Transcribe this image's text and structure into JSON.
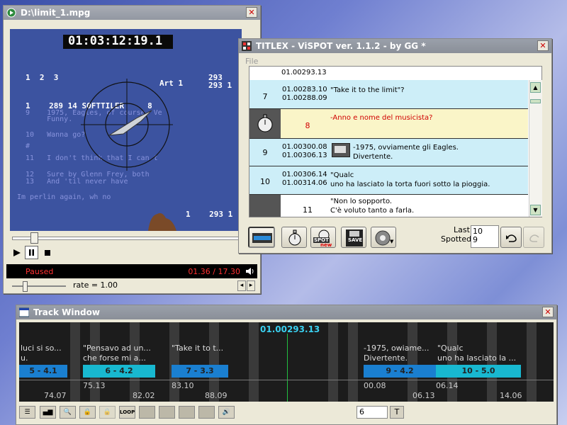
{
  "player": {
    "title": "D:\\limit_1.mpg",
    "video": {
      "timecode": "01:03:12:19.1",
      "lines": [
        "1  2  3",
        "Art 1",
        "293",
        "293 1",
        "1    289 14 SOFTTILER     8",
        "1    293 1"
      ],
      "blue_lines": [
        "9    1975, Eagles, of course. Ve",
        "     Funny.",
        "10   Wanna go?",
        "#",
        "11   I don't think that I can t",
        "12   Sure by Glenn Frey, both",
        "13   And 'til never have",
        "Im perlin again, wh no"
      ]
    },
    "status": "Paused",
    "time": "01.36 / 17.30",
    "rate": "rate = 1.00"
  },
  "titlex": {
    "title": "TITLEX - ViSPOT ver. 1.1.2 - by GG *",
    "menu_file": "File",
    "top_time": "01.00293.13",
    "rows": [
      {
        "num": "7",
        "t1": "01.00283.10",
        "t2": "01.00288.09",
        "text1": "\"Take it to the limit\"?",
        "text2": ""
      },
      {
        "num": "8",
        "t1": "",
        "t2": "",
        "text1": "-Anno e nome del musicista?",
        "text2": ""
      },
      {
        "num": "9",
        "t1": "01.00300.08",
        "t2": "01.00306.13",
        "text1": "-1975, ovviamente gli Eagles.",
        "text2": "Divertente."
      },
      {
        "num": "10",
        "t1": "01.00306.14",
        "t2": "01.00314.06",
        "text1": "\"Qualc",
        "text2": "uno ha lasciato la torta fuori sotto la pioggia."
      },
      {
        "num": "11",
        "t1": "",
        "t2": "",
        "text1": "\"Non lo sopporto.",
        "text2": "C'è voluto tanto a farla."
      }
    ],
    "last_label": "Last",
    "spotted_label": "Spotted",
    "last_value": "10",
    "spotted_value": "9",
    "btn_spot": "SPOT",
    "btn_new": "new",
    "btn_save": "SAVE"
  },
  "track": {
    "title": "Track Window",
    "current_time": "01.00293.13",
    "texts": [
      "luci si so...\nu.",
      "\"Pensavo ad un...\nche forse mi a...",
      "\"Take it to t...",
      "-1975, owiame...\nDivertente.",
      "\"Qualc\nuno ha lasciato la ..."
    ],
    "segments": [
      "5 - 4.1",
      "6 - 4.2",
      "7 - 3.3",
      "9 - 4.2",
      "10 - 5.0"
    ],
    "codes_bottom": [
      "74.07",
      "75.13",
      "82.02",
      "83.10",
      "88.09",
      "00.08",
      "06.13",
      "06.14",
      "14.06"
    ],
    "counter": "6",
    "t_button": "T",
    "loop_label": "LOOP"
  },
  "colors": {
    "row_cyan": "#cdeef8",
    "row_yellow": "#faf5c8",
    "seg_blue": "#1a7fd0",
    "seg_cyan": "#18b8d0",
    "timecode_cyan": "#3ad0f0",
    "status_red": "#ff3030"
  }
}
